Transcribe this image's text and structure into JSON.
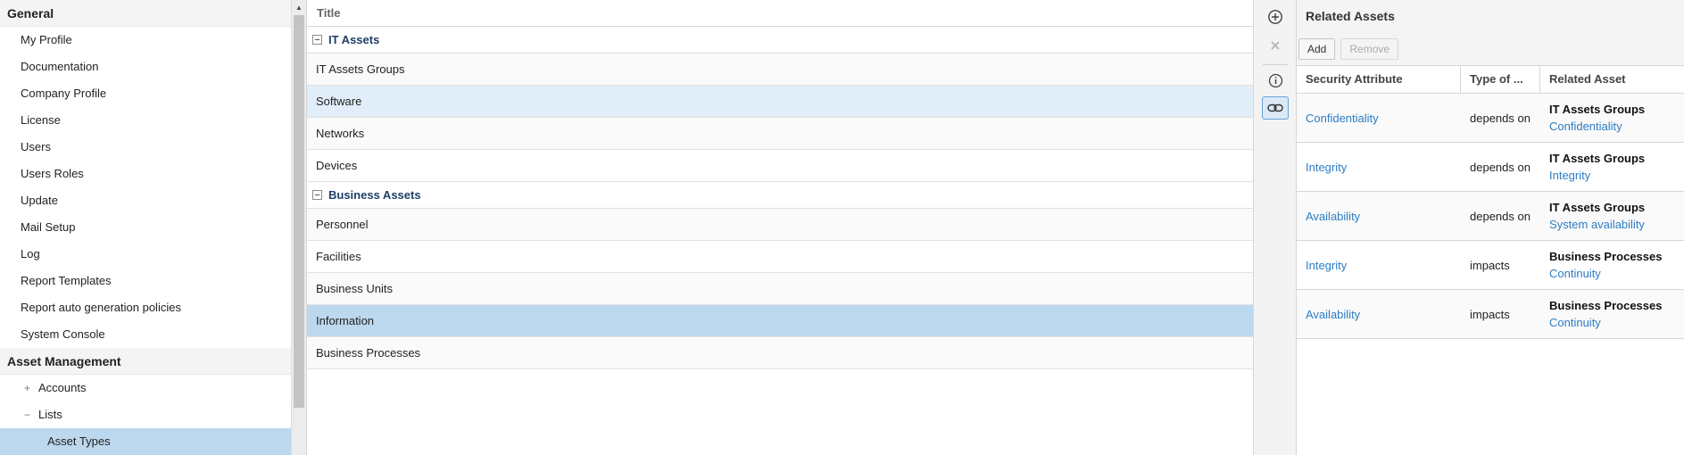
{
  "nav": {
    "sections": [
      {
        "title": "General",
        "items": [
          "My Profile",
          "Documentation",
          "Company Profile",
          "License",
          "Users",
          "Users Roles",
          "Update",
          "Mail Setup",
          "Log",
          "Report Templates",
          "Report auto generation policies",
          "System Console"
        ]
      },
      {
        "title": "Asset Management",
        "subitems": [
          {
            "toggle": "+",
            "label": "Accounts"
          },
          {
            "toggle": "−",
            "label": "Lists"
          }
        ],
        "selected_leaf": "Asset Types"
      }
    ]
  },
  "list": {
    "column_title": "Title",
    "groups": [
      {
        "label": "IT Assets",
        "rows": [
          "IT Assets Groups",
          "Software",
          "Networks",
          "Devices"
        ]
      },
      {
        "label": "Business Assets",
        "rows": [
          "Personnel",
          "Facilities",
          "Business Units",
          "Information",
          "Business Processes"
        ]
      }
    ],
    "hovered_row": "Software",
    "selected_row": "Information"
  },
  "toolbar": {
    "icons": [
      "add-circle-icon",
      "close-icon",
      "info-icon",
      "link-icon"
    ],
    "active": "link-icon"
  },
  "related": {
    "title": "Related Assets",
    "add_label": "Add",
    "remove_label": "Remove",
    "columns": [
      "Security Attribute",
      "Type of ...",
      "Related Asset"
    ],
    "rows": [
      {
        "attribute": "Confidentiality",
        "type": "depends on",
        "asset": "IT Assets Groups",
        "asset_attr": "Confidentiality"
      },
      {
        "attribute": "Integrity",
        "type": "depends on",
        "asset": "IT Assets Groups",
        "asset_attr": "Integrity"
      },
      {
        "attribute": "Availability",
        "type": "depends on",
        "asset": "IT Assets Groups",
        "asset_attr": "System availability"
      },
      {
        "attribute": "Integrity",
        "type": "impacts",
        "asset": "Business Processes",
        "asset_attr": "Continuity"
      },
      {
        "attribute": "Availability",
        "type": "impacts",
        "asset": "Business Processes",
        "asset_attr": "Continuity"
      }
    ]
  },
  "colors": {
    "link": "#2c7cc4",
    "selected": "#bcd8ef",
    "hover": "#e1edf8",
    "group_text": "#1e3f66"
  }
}
